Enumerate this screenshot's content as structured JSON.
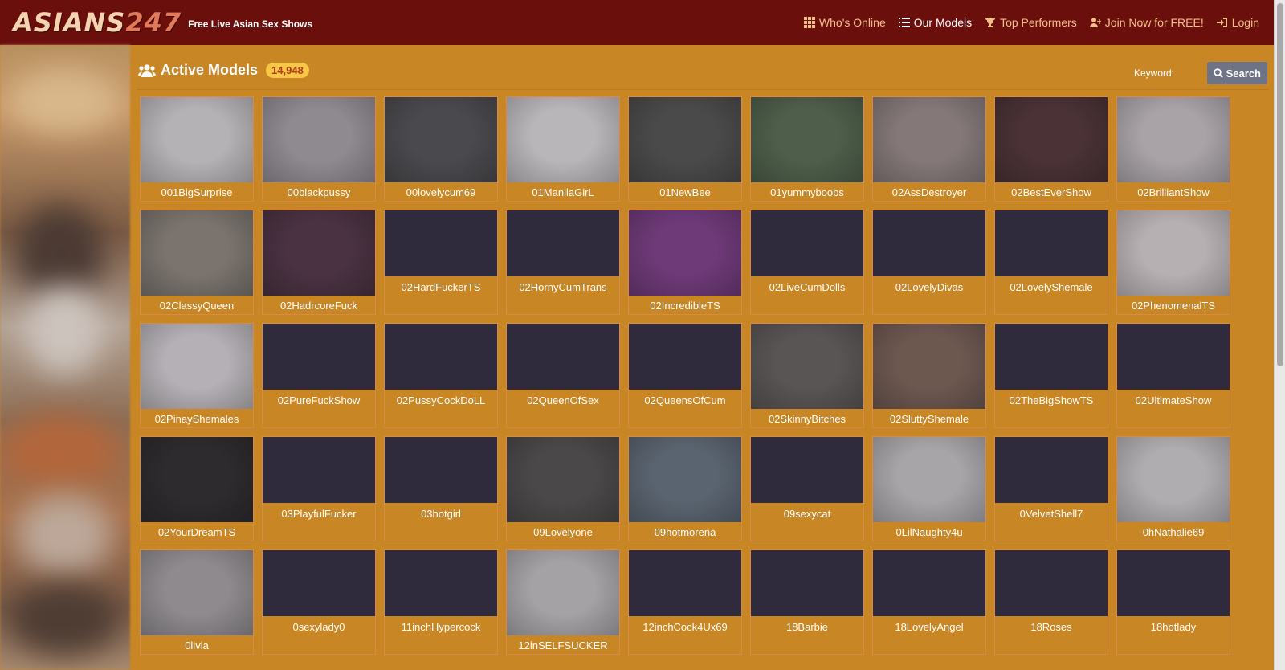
{
  "header": {
    "logo_text_main": "ASIANS",
    "logo_text_accent": "247",
    "tagline": "Free Live Asian Sex Shows",
    "nav": [
      {
        "label": "Who's Online",
        "icon": "grid-icon",
        "current": false
      },
      {
        "label": "Our Models",
        "icon": "list-icon",
        "current": true
      },
      {
        "label": "Top Performers",
        "icon": "trophy-icon",
        "current": false
      },
      {
        "label": "Join Now for FREE!",
        "icon": "user-plus-icon",
        "current": false
      },
      {
        "label": "Login",
        "icon": "sign-in-icon",
        "current": false
      }
    ]
  },
  "main": {
    "title": "Active Models",
    "count": "14,948",
    "keyword_label": "Keyword:",
    "search_label": "Search"
  },
  "colors": {
    "header_bg": "#6b0f0c",
    "page_bg": "#c98625",
    "badge_bg": "#f6c845",
    "placeholder_thumb": "#2f2b3c"
  },
  "models": [
    {
      "name": "001BigSurprise",
      "thumb": "#b5b2b5"
    },
    {
      "name": "00blackpussy",
      "thumb": "#8f8a90"
    },
    {
      "name": "00lovelycum69",
      "thumb": "#4a4a4e"
    },
    {
      "name": "01ManilaGirL",
      "thumb": "#b9b6ba"
    },
    {
      "name": "01NewBee",
      "thumb": "#4b4a4a"
    },
    {
      "name": "01yummyboobs",
      "thumb": "#4e5e4a"
    },
    {
      "name": "02AssDestroyer",
      "thumb": "#847878"
    },
    {
      "name": "02BestEverShow",
      "thumb": "#4a3236"
    },
    {
      "name": "02BrilliantShow",
      "thumb": "#a9a3a8"
    },
    {
      "name": "02ClassyQueen",
      "thumb": "#7a736e"
    },
    {
      "name": "02HadrcoreFuck",
      "thumb": "#4a3242"
    },
    {
      "name": "02HardFuckerTS",
      "thumb": null
    },
    {
      "name": "02HornyCumTrans",
      "thumb": null
    },
    {
      "name": "02IncredibleTS",
      "thumb": "#6e3a78"
    },
    {
      "name": "02LiveCumDolls",
      "thumb": null
    },
    {
      "name": "02LovelyDivas",
      "thumb": null
    },
    {
      "name": "02LovelyShemale",
      "thumb": null
    },
    {
      "name": "02PhenomenalTS",
      "thumb": "#b7b0b2"
    },
    {
      "name": "02PinayShemales",
      "thumb": "#b4b0b5"
    },
    {
      "name": "02PureFuckShow",
      "thumb": null
    },
    {
      "name": "02PussyCockDoLL",
      "thumb": null
    },
    {
      "name": "02QueenOfSex",
      "thumb": null
    },
    {
      "name": "02QueensOfCum",
      "thumb": null
    },
    {
      "name": "02SkinnyBitches",
      "thumb": "#5a5555"
    },
    {
      "name": "02SluttyShemale",
      "thumb": "#6d5850"
    },
    {
      "name": "02TheBigShowTS",
      "thumb": null
    },
    {
      "name": "02UltimateShow",
      "thumb": null
    },
    {
      "name": "02YourDreamTS",
      "thumb": "#2e2b2e"
    },
    {
      "name": "03PlayfulFucker",
      "thumb": null
    },
    {
      "name": "03hotgirl",
      "thumb": null
    },
    {
      "name": "09Lovelyone",
      "thumb": "#4a4848"
    },
    {
      "name": "09hotmorena",
      "thumb": "#5a6470"
    },
    {
      "name": "09sexycat",
      "thumb": null
    },
    {
      "name": "0LilNaughty4u",
      "thumb": "#a8a5a8"
    },
    {
      "name": "0VelvetShell7",
      "thumb": null
    },
    {
      "name": "0hNathalie69",
      "thumb": "#b0adb0"
    },
    {
      "name": "0livia",
      "thumb": "#8e8a8e"
    },
    {
      "name": "0sexylady0",
      "thumb": null
    },
    {
      "name": "11inchHypercock",
      "thumb": null
    },
    {
      "name": "12inSELFSUCKER",
      "thumb": "#a5a2a5"
    },
    {
      "name": "12inchCock4Ux69",
      "thumb": null
    },
    {
      "name": "18Barbie",
      "thumb": null
    },
    {
      "name": "18LovelyAngel",
      "thumb": null
    },
    {
      "name": "18Roses",
      "thumb": null
    },
    {
      "name": "18hotlady",
      "thumb": null
    }
  ]
}
